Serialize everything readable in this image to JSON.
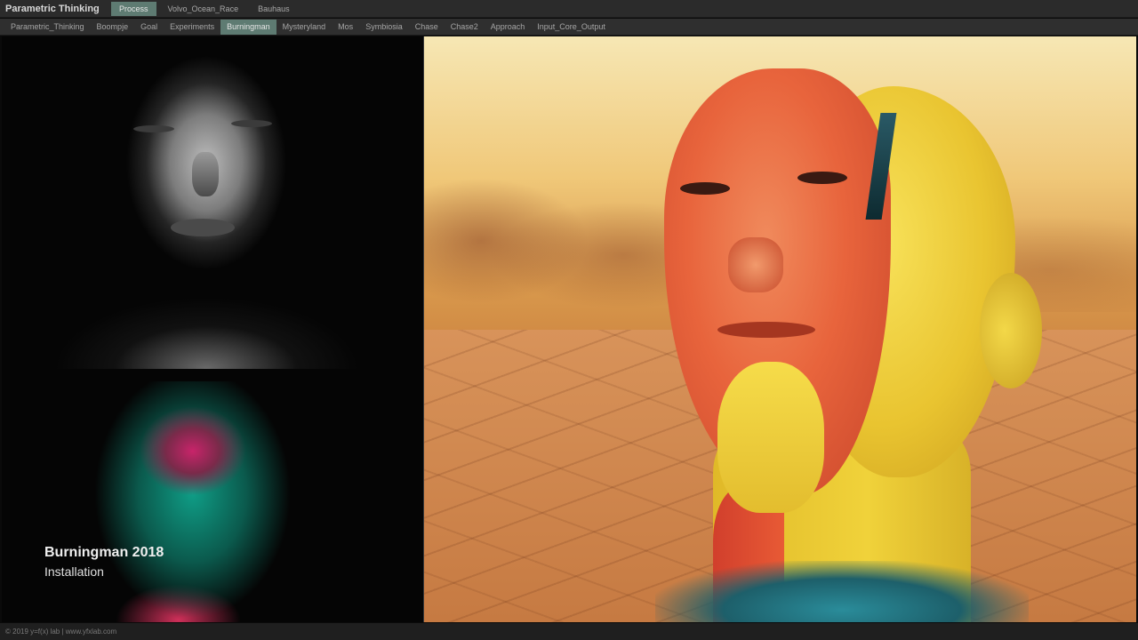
{
  "app": {
    "title": "Parametric Thinking"
  },
  "top_tabs": [
    {
      "label": "Process",
      "active": true
    },
    {
      "label": "Volvo_Ocean_Race",
      "active": false
    },
    {
      "label": "Bauhaus",
      "active": false
    }
  ],
  "sub_tabs": [
    {
      "label": "Parametric_Thinking",
      "active": false
    },
    {
      "label": "Boompje",
      "active": false
    },
    {
      "label": "Goal",
      "active": false
    },
    {
      "label": "Experiments",
      "active": false
    },
    {
      "label": "Burningman",
      "active": true
    },
    {
      "label": "Mysteryland",
      "active": false
    },
    {
      "label": "Mos",
      "active": false
    },
    {
      "label": "Symbiosia",
      "active": false
    },
    {
      "label": "Chase",
      "active": false
    },
    {
      "label": "Chase2",
      "active": false
    },
    {
      "label": "Approach",
      "active": false
    },
    {
      "label": "Input_Core_Output",
      "active": false
    }
  ],
  "caption": {
    "title": "Burningman 2018",
    "subtitle": "Installation"
  },
  "footer": {
    "text": "© 2019 y=f(x) lab | www.yfxlab.com"
  },
  "colors": {
    "active_tab": "#5e7b72",
    "topbar": "#2b2b2b",
    "subbar": "#2f2f2f",
    "background": "#0a0a0a"
  }
}
